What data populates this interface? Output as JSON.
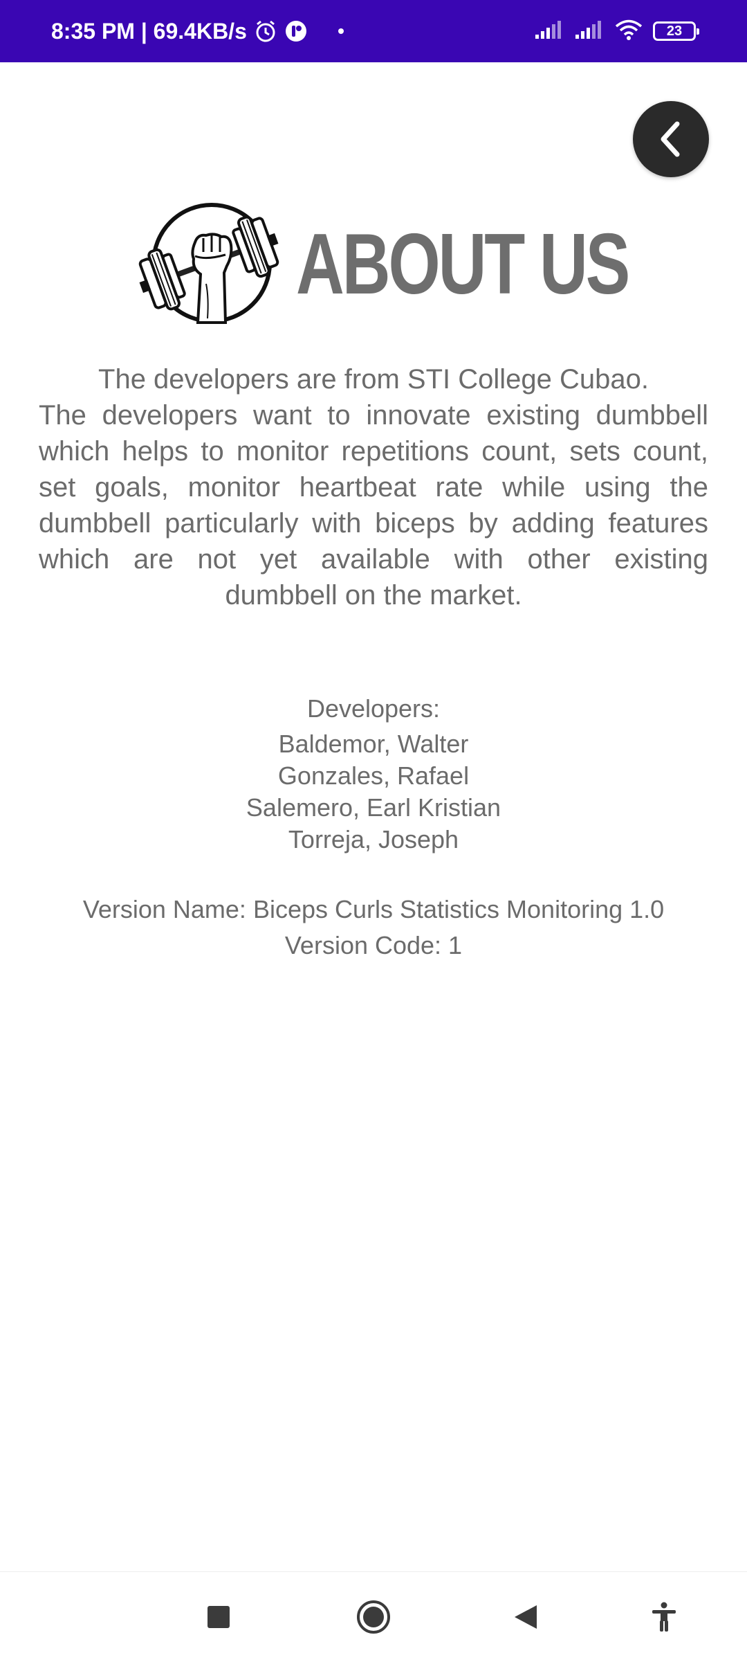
{
  "status_bar": {
    "time_speed": "8:35 PM | 69.4KB/s",
    "battery_level": "23",
    "icons": [
      "alarm-icon",
      "app-notification-icon",
      "dot-icon",
      "signal-icon",
      "signal-icon-2",
      "wifi-icon",
      "battery-icon"
    ],
    "background_color": "#3a06b3"
  },
  "back_button": {
    "icon": "chevron-left-icon"
  },
  "header": {
    "title": "ABOUT US",
    "logo_icon": "dumbbell-fist-logo"
  },
  "description": {
    "first_line": "The developers are from STI College Cubao.",
    "body": "The developers want to innovate existing dumbbell which helps to monitor repetitions count, sets count, set goals, monitor heartbeat rate while using the dumbbell particularly with biceps by adding features which are not yet available with other existing dumbbell on the market."
  },
  "developers": {
    "heading": "Developers:",
    "names": [
      "Baldemor, Walter",
      "Gonzales, Rafael",
      "Salemero, Earl Kristian",
      "Torreja, Joseph"
    ]
  },
  "version": {
    "name": "Version Name: Biceps Curls Statistics Monitoring 1.0",
    "code": "Version Code: 1"
  },
  "nav_bar": {
    "icons": [
      "recents-square-icon",
      "home-circle-icon",
      "back-triangle-icon",
      "accessibility-icon"
    ]
  }
}
